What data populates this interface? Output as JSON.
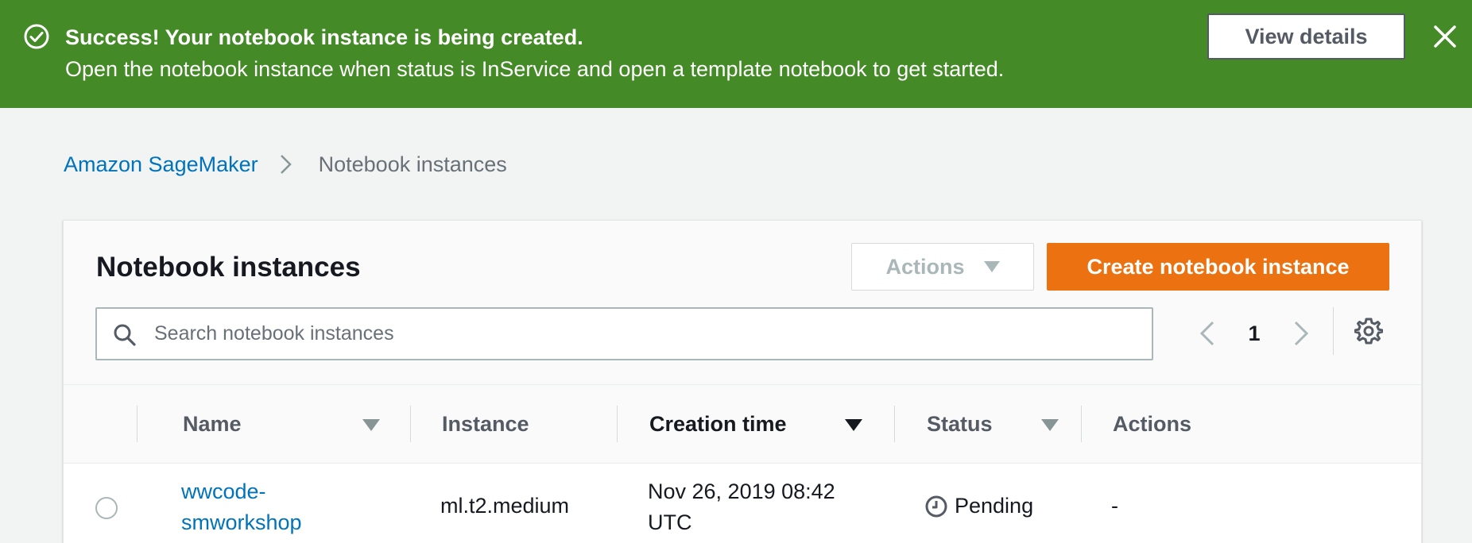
{
  "flash": {
    "title": "Success! Your notebook instance is being created.",
    "message": "Open the notebook instance when status is InService and open a template notebook to get started.",
    "view_details_label": "View details",
    "icons": {
      "status": "success-check-icon",
      "close": "close-icon"
    },
    "color": "#448a27"
  },
  "breadcrumb": {
    "items": [
      "Amazon SageMaker",
      "Notebook instances"
    ]
  },
  "panel": {
    "title": "Notebook instances",
    "actions_label": "Actions",
    "create_label": "Create notebook instance",
    "search_placeholder": "Search notebook instances",
    "search_value": "",
    "page": "1",
    "accent_color": "#ec7211"
  },
  "table": {
    "columns": [
      "Name",
      "Instance",
      "Creation time",
      "Status",
      "Actions"
    ],
    "sorted_column": "Creation time",
    "rows": [
      {
        "name_line1": "wwcode-",
        "name_line2": "smworkshop",
        "instance": "ml.t2.medium",
        "creation_line1": "Nov 26, 2019 08:42",
        "creation_line2": "UTC",
        "status": "Pending",
        "actions": "-"
      }
    ]
  }
}
